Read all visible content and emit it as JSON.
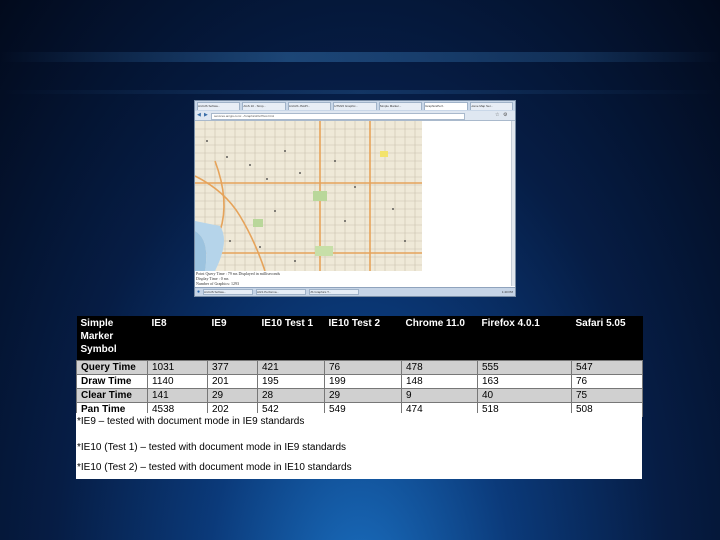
{
  "browser": {
    "tabs": [
      "ArcGIS Softwa...",
      "AGS 10 - Simp...",
      "ArcGIS JSAPI...",
      "HTML5 Graphic...",
      "Simple Marker...",
      "GraphicsPerf..",
      "Home Map Ser..."
    ],
    "active_tab": 5,
    "url": "services.arcgis.com/.../GraphicsPerfTest.html",
    "caption_lines": [
      "Point Query Time : 79 ms  Displayed in milliseconds",
      "Display Time : 0 ms",
      "Number of Graphics: 1293"
    ],
    "taskbar_items": [
      "ArcGIS Softwa...",
      "AGS Performa...",
      "JS Graphics T..."
    ],
    "clock": "1:40 PM"
  },
  "table": {
    "headers": [
      "Simple Marker Symbol",
      "IE8",
      "IE9",
      "IE10 Test 1",
      "IE10 Test 2",
      "Chrome 11.0",
      "Firefox 4.0.1",
      "Safari 5.05"
    ],
    "rows": [
      [
        "Query Time",
        "1031",
        "377",
        "421",
        "76",
        "478",
        "555",
        "547"
      ],
      [
        "Draw Time",
        "1140",
        "201",
        "195",
        "199",
        "148",
        "163",
        "76"
      ],
      [
        "Clear Time",
        "141",
        "29",
        "28",
        "29",
        "9",
        "40",
        "75"
      ],
      [
        "Pan Time",
        "4538",
        "202",
        "542",
        "549",
        "474",
        "518",
        "508"
      ]
    ]
  },
  "notes": [
    "*IE9 – tested with document mode in IE9 standards",
    "*IE10 (Test 1) – tested with document mode in IE9 standards",
    "*IE10 (Test 2) – tested with document mode in IE10 standards"
  ]
}
